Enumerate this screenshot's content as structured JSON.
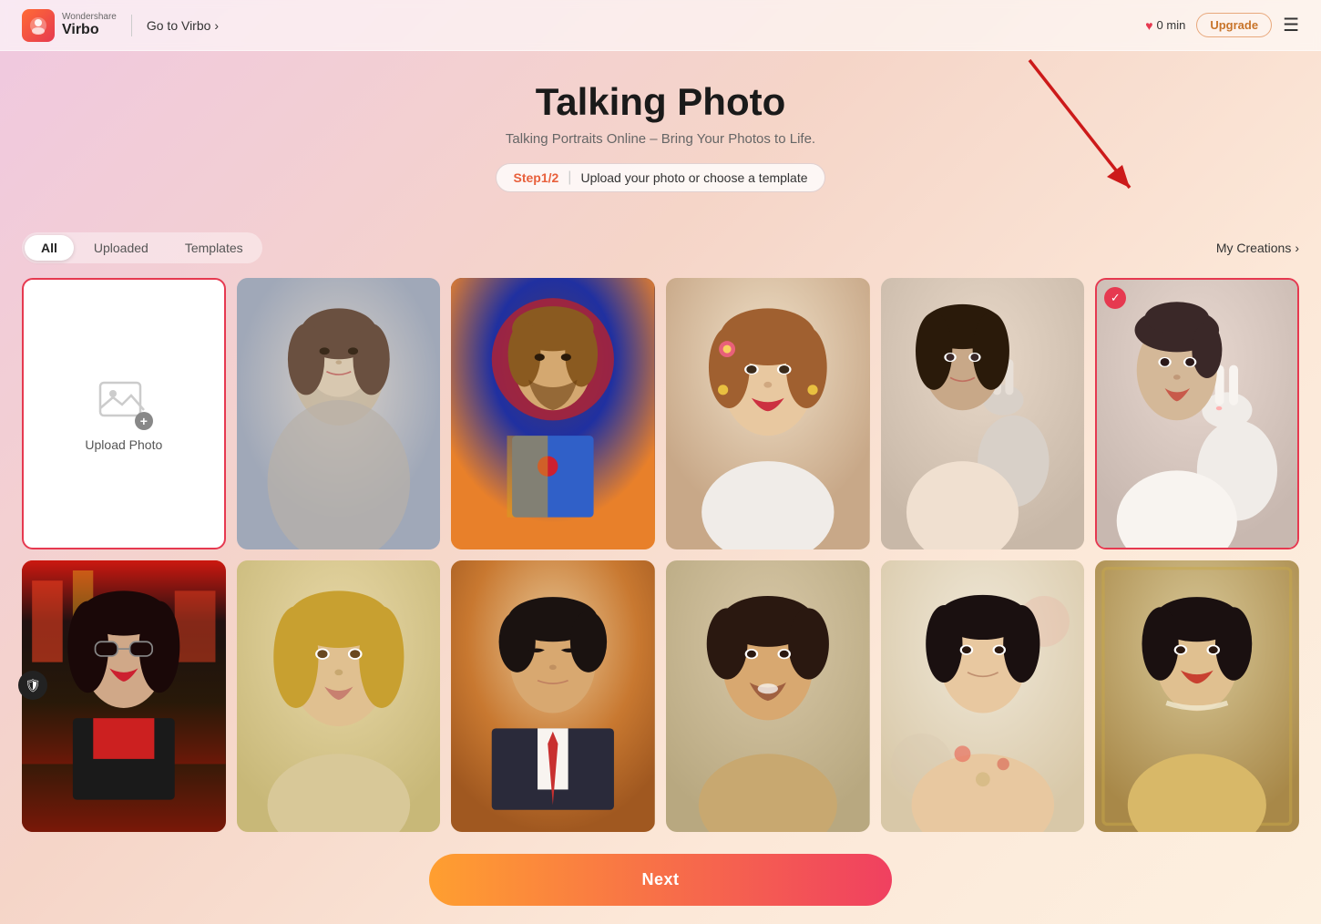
{
  "header": {
    "brand": "Wondershare",
    "product": "Virbo",
    "goto_label": "Go to Virbo",
    "time_label": "0 min",
    "upgrade_label": "Upgrade"
  },
  "page": {
    "title": "Talking Photo",
    "subtitle": "Talking Portraits Online – Bring Your Photos to Life.",
    "step_label": "Step1/2",
    "step_desc": "Upload your photo or choose a template"
  },
  "tabs": {
    "all_label": "All",
    "uploaded_label": "Uploaded",
    "templates_label": "Templates",
    "my_creations_label": "My Creations"
  },
  "upload_card": {
    "label": "Upload Photo"
  },
  "next_btn": {
    "label": "Next"
  }
}
